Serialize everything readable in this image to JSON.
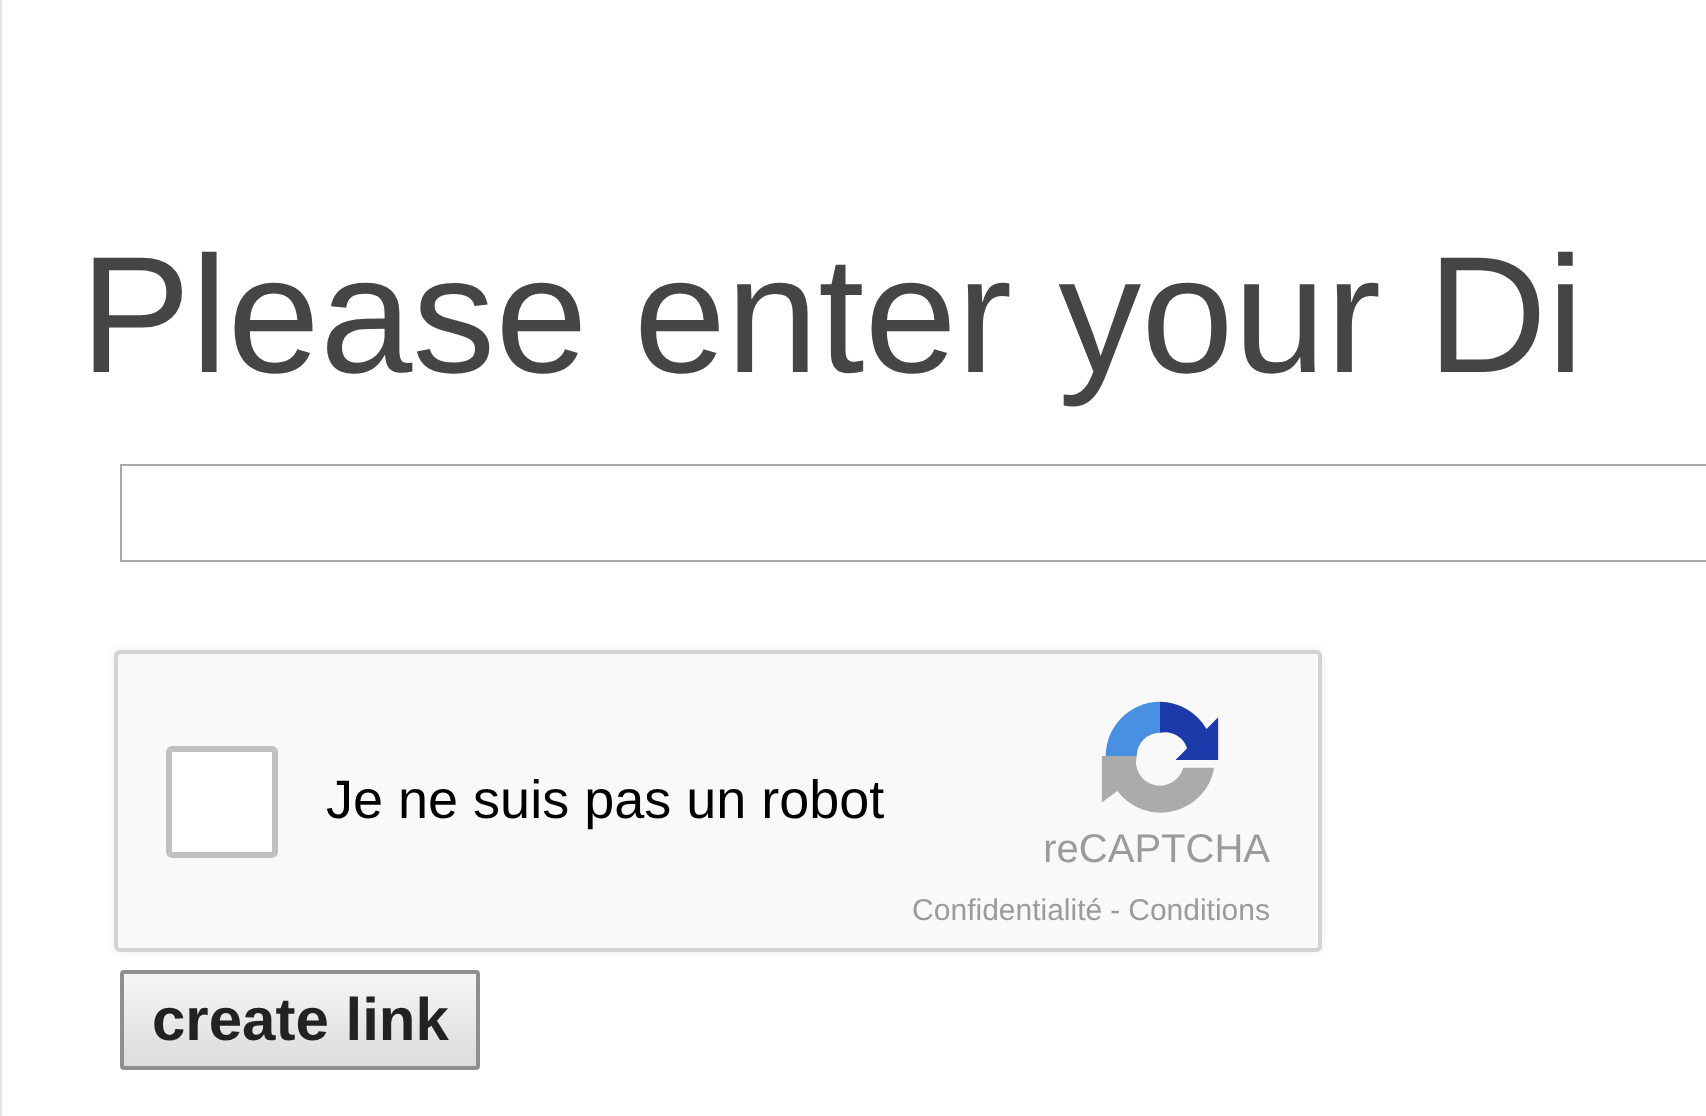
{
  "heading": "Please enter your Di",
  "captcha": {
    "checked": false,
    "label": "Je ne suis pas un robot",
    "brand": "reCAPTCHA",
    "privacy_link": "Confidentialité",
    "separator": "-",
    "terms_link": "Conditions"
  },
  "submit_button": "create link"
}
